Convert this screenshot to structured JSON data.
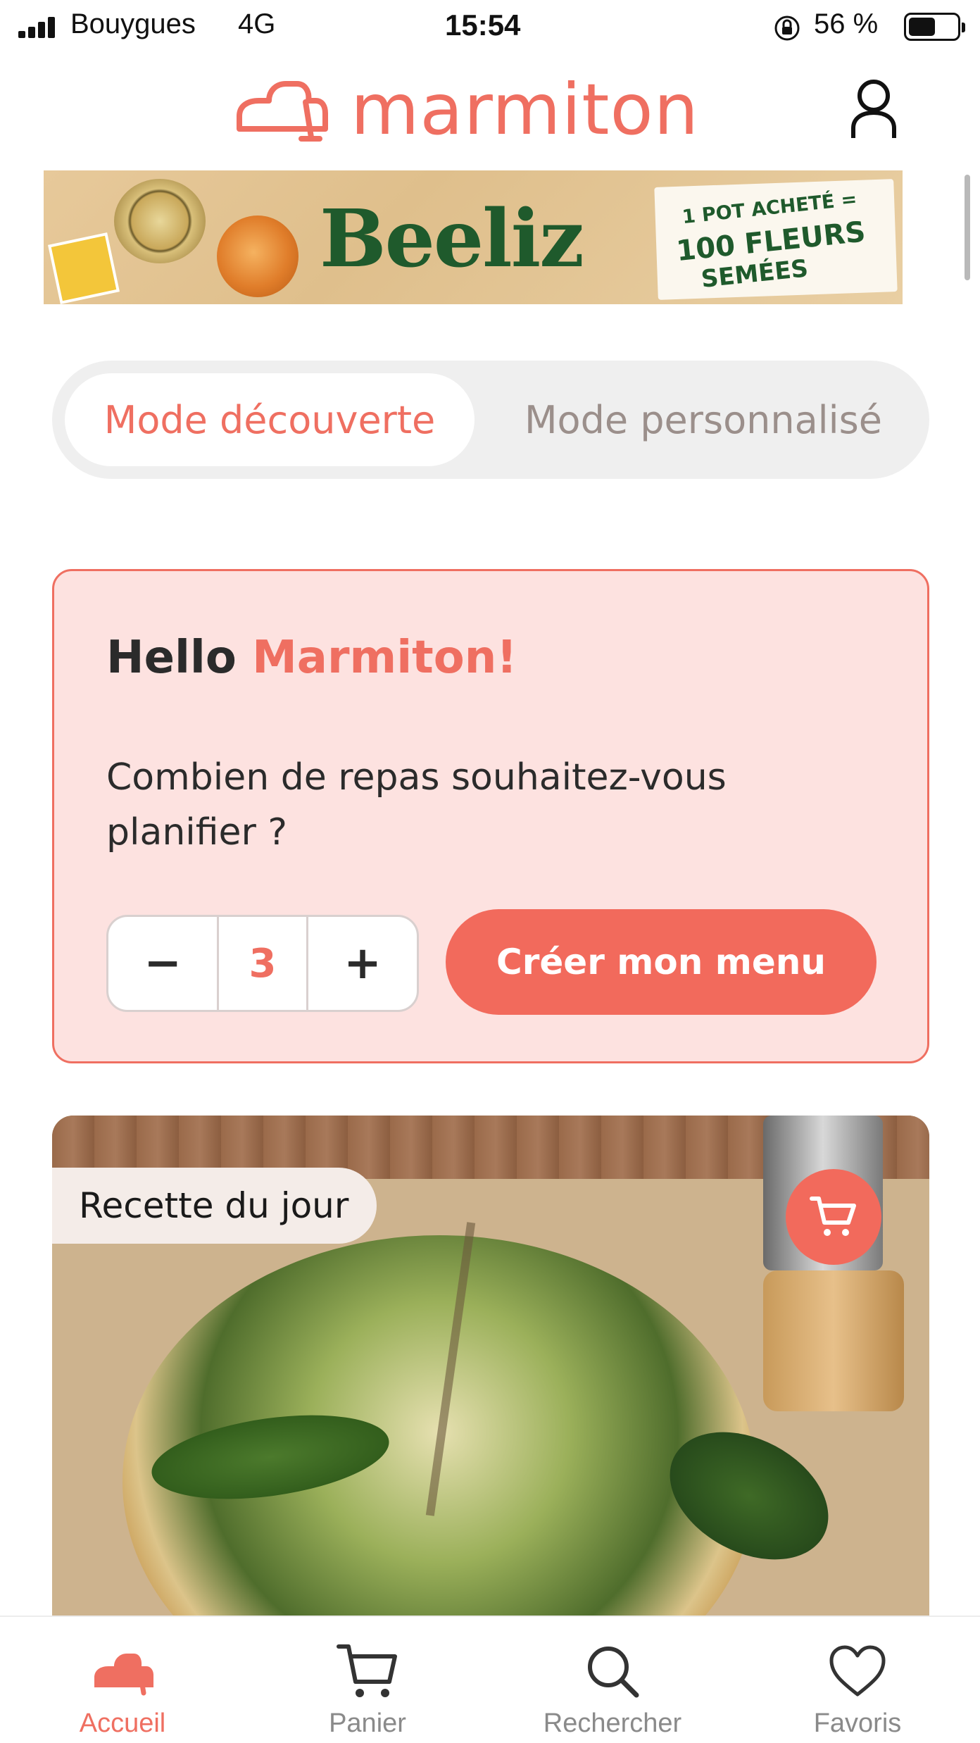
{
  "status_bar": {
    "carrier": "Bouygues",
    "network": "4G",
    "time": "15:54",
    "battery": "56 %",
    "battery_level": 0.56
  },
  "header": {
    "brand": "marmiton",
    "brand_color": "#ef6f61"
  },
  "banner": {
    "brand": "Beeliz",
    "line1": "1 POT ACHETÉ =",
    "line2": "100 FLEURS",
    "line3": "SEMÉES"
  },
  "mode_toggle": {
    "active_label": "Mode découverte",
    "inactive_label": "Mode personnalisé"
  },
  "hello_card": {
    "greeting": "Hello",
    "name": "Marmiton!",
    "question": "Combien de repas souhaitez-vous planifier ?",
    "stepper": {
      "minus": "−",
      "value": "3",
      "plus": "+"
    },
    "create_button": "Créer mon menu"
  },
  "recipe_card": {
    "badge": "Recette du jour"
  },
  "tabbar": {
    "items": [
      {
        "label": "Accueil",
        "icon": "home-pot-icon",
        "active": true
      },
      {
        "label": "Panier",
        "icon": "cart-icon",
        "active": false
      },
      {
        "label": "Rechercher",
        "icon": "search-icon",
        "active": false
      },
      {
        "label": "Favoris",
        "icon": "heart-icon",
        "active": false
      }
    ],
    "accent": "#ef6f61"
  }
}
